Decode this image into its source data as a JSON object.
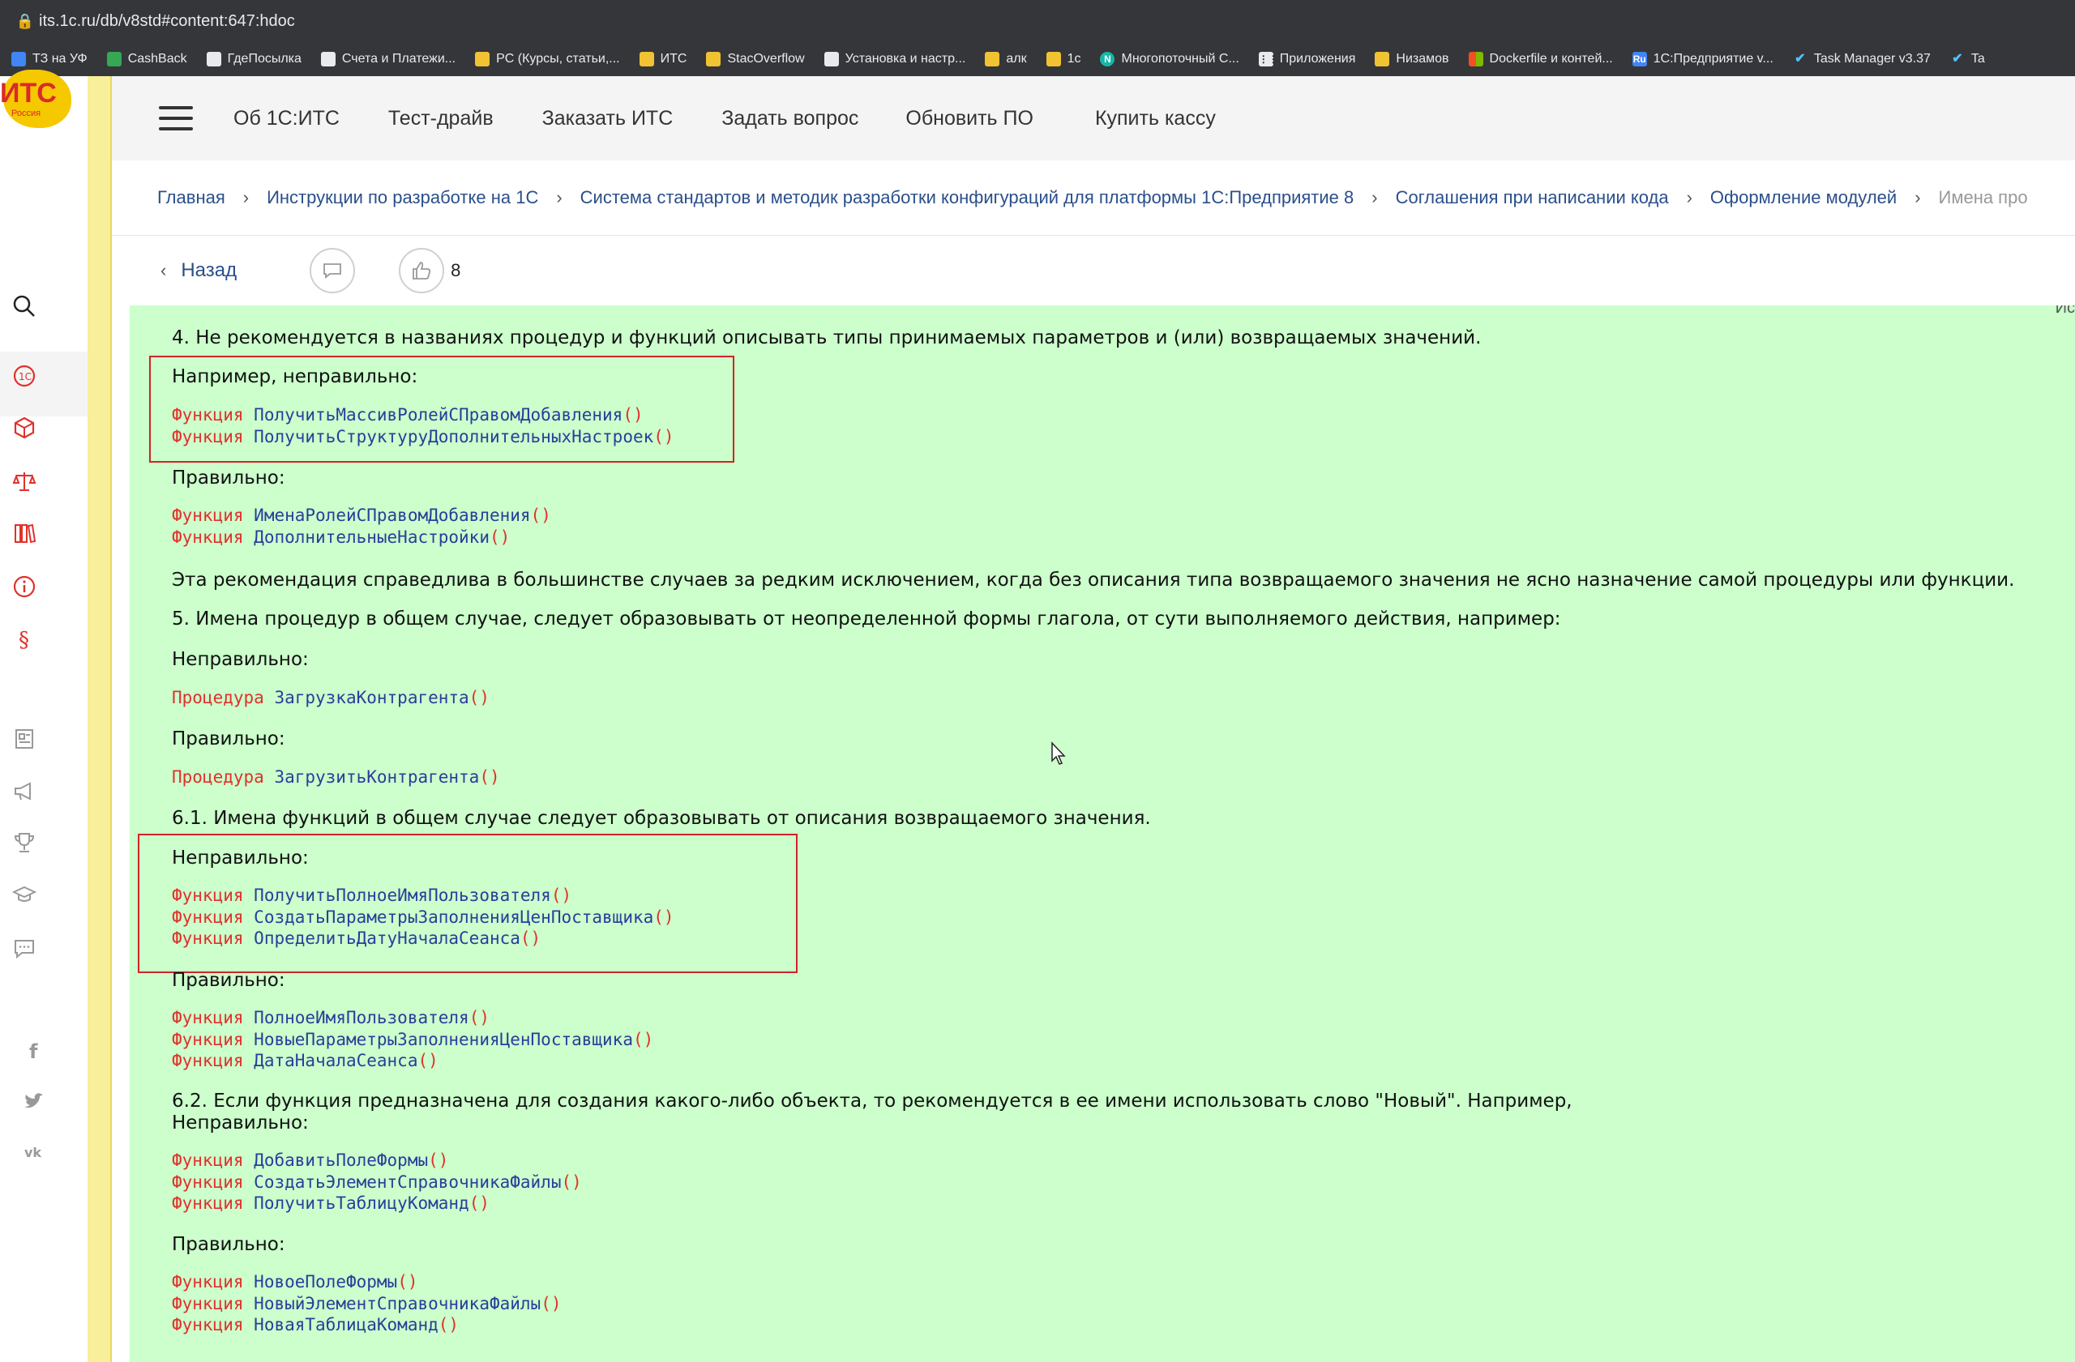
{
  "browser": {
    "url": "its.1c.ru/db/v8std#content:647:hdoc",
    "bookmarks": [
      {
        "label": "ТЗ на УФ",
        "icon": "blue-script-icon"
      },
      {
        "label": "CashBack",
        "icon": "green-square-icon"
      },
      {
        "label": "ГдеПосылка",
        "icon": "search-page-icon"
      },
      {
        "label": "Счета и Платежи...",
        "icon": "gear-icon"
      },
      {
        "label": "PC (Курсы, статьи,...",
        "icon": "folder-icon"
      },
      {
        "label": "ИТС",
        "icon": "folder-icon"
      },
      {
        "label": "StacOverflow",
        "icon": "folder-icon"
      },
      {
        "label": "Установка и настр...",
        "icon": "globe-icon"
      },
      {
        "label": "алк",
        "icon": "folder-icon"
      },
      {
        "label": "1с",
        "icon": "folder-icon"
      },
      {
        "label": "Многопоточный С...",
        "icon": "n-circle-icon"
      },
      {
        "label": "Приложения",
        "icon": "apps-grid-icon"
      },
      {
        "label": "Низамов",
        "icon": "folder-icon"
      },
      {
        "label": "Dockerfile и контей...",
        "icon": "microsoft-icon"
      },
      {
        "label": "1С:Предприятие v...",
        "icon": "ru-icon"
      },
      {
        "label": "Task Manager v3.37",
        "icon": "check-icon"
      },
      {
        "label": "Ta",
        "icon": "check-icon"
      }
    ]
  },
  "logo": {
    "text": "ИТС",
    "sub": "Россия"
  },
  "topnav": {
    "links": [
      "Об 1С:ИТС",
      "Тест-драйв",
      "Заказать ИТС",
      "Задать вопрос",
      "Обновить ПО",
      "Купить кассу"
    ]
  },
  "breadcrumb": [
    "Главная",
    "Инструкции по разработке на 1С",
    "Система стандартов и методик разработки конфигураций для платформы 1С:Предприятие 8",
    "Соглашения при написании кода",
    "Оформление модулей",
    "Имена про"
  ],
  "actions": {
    "back_label": "Назад",
    "like_count": "8",
    "corner_text": "Источ"
  },
  "content": {
    "p4": "4. Не рекомендуется в названиях процедур и функций описывать типы принимаемых параметров и (или) возвращаемых значений.",
    "example_wrong": "Например, неправильно:",
    "wrong1_fn": "Функция",
    "wrong1_a": "ПолучитьМассивРолейСПравомДобавления",
    "wrong1_b": "ПолучитьСтруктуруДополнительныхНастроек",
    "correct": "Правильно:",
    "right1_a": "ИменаРолейСПравомДобавления",
    "right1_b": "ДополнительныеНастройки",
    "note": "Эта рекомендация справедлива в большинстве случаев за редким исключением, когда без описания типа возвращаемого значения не ясно назначение самой процедуры или функции.",
    "p5": "5. Имена процедур в общем случае, следует образовывать от неопределенной формы глагола, от сути выполняемого действия, например:",
    "wrong": "Неправильно:",
    "proc": "Процедура",
    "p5_wrong": "ЗагрузкаКонтрагента",
    "p5_right": "ЗагрузитьКонтрагента",
    "p61": "6.1. Имена функций в общем случае следует образовывать от описания возвращаемого значения.",
    "p61_wrong_a": "ПолучитьПолноеИмяПользователя",
    "p61_wrong_b": "СоздатьПараметрыЗаполненияЦенПоставщика",
    "p61_wrong_c": "ОпределитьДатуНачалаСеанса",
    "p61_right_a": "ПолноеИмяПользователя",
    "p61_right_b": "НовыеПараметрыЗаполненияЦенПоставщика",
    "p61_right_c": "ДатаНачалаСеанса",
    "p62": "6.2. Если функция предназначена для создания какого-либо объекта, то рекомендуется в ее имени использовать слово \"Новый\". Например,",
    "p62_wrong_a": "ДобавитьПолеФормы",
    "p62_wrong_b": "СоздатьЭлементСправочникаФайлы",
    "p62_wrong_c": "ПолучитьТаблицуКоманд",
    "p62_right_a": "НовоеПолеФормы",
    "p62_right_b": "НовыйЭлементСправочникаФайлы",
    "p62_right_c": "НоваяТаблицаКоманд",
    "parens": "()"
  }
}
